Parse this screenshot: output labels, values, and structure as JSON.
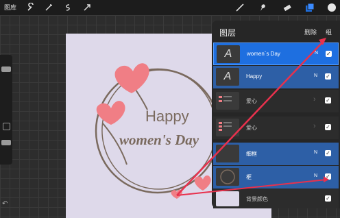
{
  "topbar": {
    "library_label": "图库",
    "tools": [
      "wrench-icon",
      "magic-wand-icon",
      "selection-icon",
      "transform-icon",
      "brush-icon",
      "smudge-icon",
      "eraser-icon",
      "layers-icon",
      "color-icon"
    ]
  },
  "canvas": {
    "line1": "Happy",
    "line2": "women's Day",
    "colors": {
      "artboard": "#ded9ea",
      "heart": "#f07e85",
      "text": "#7a6a5e"
    }
  },
  "layers_panel": {
    "title": "图层",
    "delete_label": "删除",
    "group_label": "组",
    "rows": [
      {
        "label": "women`s Day",
        "mode": "N",
        "checked": true,
        "thumb": "A"
      },
      {
        "label": "Happy",
        "mode": "N",
        "checked": true,
        "thumb": "A"
      },
      {
        "label": "爱心",
        "mode": "",
        "checked": true,
        "thumb": ""
      },
      {
        "label": "爱心",
        "mode": "",
        "checked": true,
        "thumb": ""
      },
      {
        "label": "细框",
        "mode": "N",
        "checked": true,
        "thumb": ""
      },
      {
        "label": "框",
        "mode": "N",
        "checked": true,
        "thumb": ""
      },
      {
        "label": "背景颜色",
        "mode": "",
        "checked": true,
        "thumb": ""
      }
    ]
  },
  "annotation": {
    "color": "#e8314d"
  }
}
